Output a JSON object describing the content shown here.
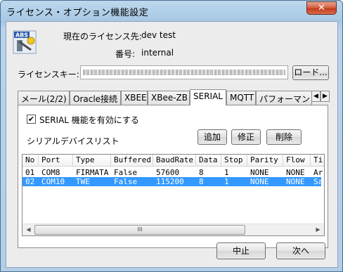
{
  "window": {
    "title": "ライセンス・オプション機能設定",
    "close_glyph": "✕"
  },
  "app_icon": {
    "name": "abs-app-icon",
    "text": "ABS"
  },
  "license_info": {
    "owner_label": "現在のライセンス先:",
    "owner_value": "dev test",
    "number_label": "番号:",
    "number_value": "internal"
  },
  "license_key": {
    "label": "ライセンスキー:",
    "load_button": "ロード..."
  },
  "tabs": [
    {
      "label": "メール(2/2)"
    },
    {
      "label": "Oracle接続"
    },
    {
      "label": "XBEE"
    },
    {
      "label": "XBee-ZB"
    },
    {
      "label": "SERIAL"
    },
    {
      "label": "MQTT"
    },
    {
      "label": "パフォーマン"
    }
  ],
  "tab_scroll": {
    "left": "◀",
    "right": "▶"
  },
  "serial": {
    "enable_checked": true,
    "check_glyph": "✔",
    "enable_label": "SERIAL 機能を有効にする",
    "list_title": "シリアルデバイスリスト",
    "add_button": "追加",
    "edit_button": "修正",
    "delete_button": "削除",
    "columns": [
      "No",
      "Port",
      "Type",
      "Buffered",
      "BaudRate",
      "Data",
      "Stop",
      "Parity",
      "Flow",
      "Ti"
    ],
    "rows": [
      {
        "no": "01",
        "port": "COM8",
        "type": "FIRMATA",
        "buffered": "False",
        "baud": "57600",
        "data": "8",
        "stop": "1",
        "parity": "NONE",
        "flow": "NONE",
        "ti": "Ard",
        "selected": false
      },
      {
        "no": "02",
        "port": "COM10",
        "type": "TWE",
        "buffered": "False",
        "baud": "115200",
        "data": "8",
        "stop": "1",
        "parity": "NONE",
        "flow": "NONE",
        "ti": "Sa",
        "selected": true
      }
    ],
    "scroll_left": "◀",
    "scroll_right": "▶",
    "scroll_grip": "III"
  },
  "footer": {
    "cancel_button": "中止",
    "next_button": "次へ"
  }
}
